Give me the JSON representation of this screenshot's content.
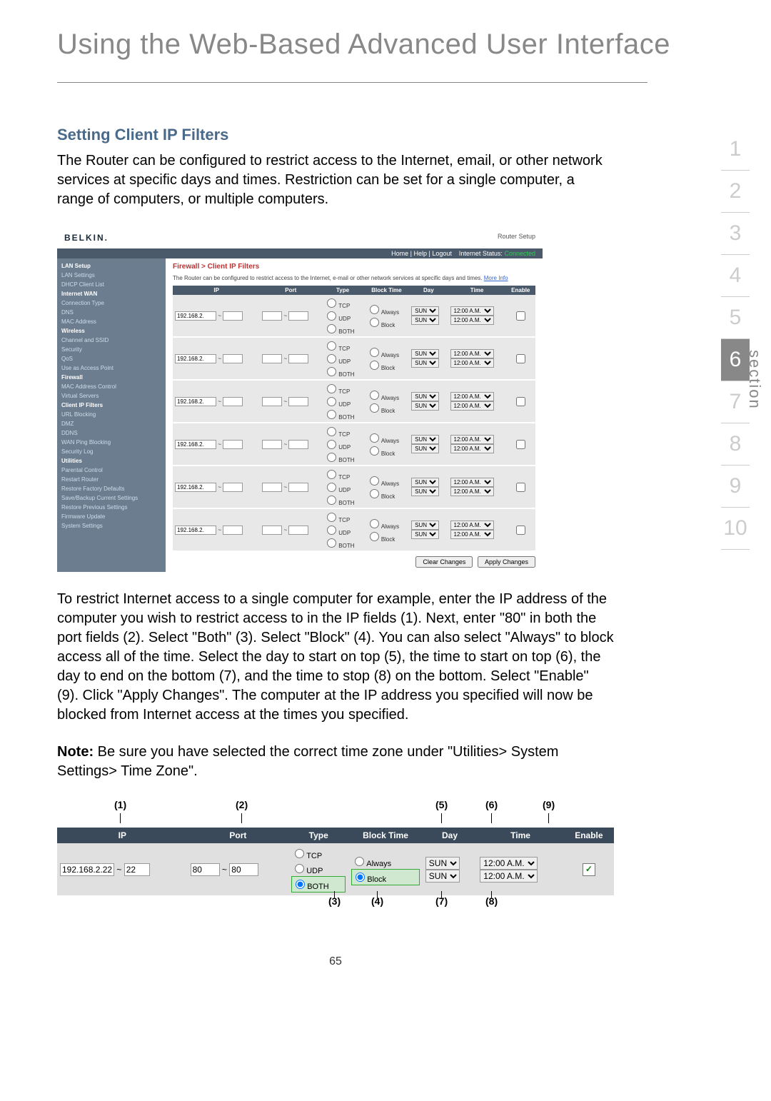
{
  "page_title": "Using the Web-Based Advanced User Interface",
  "section_nav": {
    "items": [
      "1",
      "2",
      "3",
      "4",
      "5",
      "6",
      "7",
      "8",
      "9",
      "10"
    ],
    "active": "6",
    "label": "section"
  },
  "subheading": "Setting Client IP Filters",
  "intro_text": "The Router can be configured to restrict access to the Internet, email, or other network services at specific days and times. Restriction can be set for a single computer, a range of computers, or multiple computers.",
  "router": {
    "brand": "BELKIN.",
    "subtitle": "Router Setup",
    "toplinks": "Home | Help | Logout",
    "status_label": "Internet Status:",
    "status_value": "Connected",
    "nav_groups": [
      {
        "cat": "LAN Setup",
        "items": [
          "LAN Settings",
          "DHCP Client List"
        ]
      },
      {
        "cat": "Internet WAN",
        "items": [
          "Connection Type",
          "DNS",
          "MAC Address"
        ]
      },
      {
        "cat": "Wireless",
        "items": [
          "Channel and SSID",
          "Security",
          "QoS",
          "Use as Access Point"
        ]
      },
      {
        "cat": "Firewall",
        "items": [
          "MAC Address Control",
          "Virtual Servers",
          "Client IP Filters",
          "URL Blocking",
          "DMZ",
          "DDNS",
          "WAN Ping Blocking",
          "Security Log"
        ]
      },
      {
        "cat": "Utilities",
        "items": [
          "Parental Control",
          "Restart Router",
          "Restore Factory Defaults",
          "Save/Backup Current Settings",
          "Restore Previous Settings",
          "Firmware Update",
          "System Settings"
        ]
      }
    ],
    "breadcrumb": "Firewall > Client IP Filters",
    "description": "The Router can be configured to restrict access to the Internet, e-mail or other network services at specific days and times.",
    "more_info": "More Info",
    "cols": [
      "IP",
      "Port",
      "Type",
      "Block Time",
      "Day",
      "Time",
      "Enable"
    ],
    "row": {
      "ip_prefix": "192.168.2.",
      "types": [
        "TCP",
        "UDP",
        "BOTH"
      ],
      "block_opts": [
        "Always",
        "Block"
      ],
      "day": "SUN",
      "time": "12:00 A.M."
    },
    "row_count": 6,
    "buttons": {
      "clear": "Clear Changes",
      "apply": "Apply Changes"
    }
  },
  "instructions": "To restrict Internet access to a single computer for example, enter the IP address of the computer you wish to restrict access to in the IP fields (1). Next, enter \"80\" in both the port fields (2). Select \"Both\" (3). Select \"Block\" (4). You can also select \"Always\" to block access all of the time. Select the day to start on top (5), the time to start on top (6), the day to end on the bottom (7), and the time to stop (8) on the bottom. Select \"Enable\" (9). Click \"Apply Changes\". The computer at the IP address you specified will now be blocked from Internet access at the times you specified.",
  "note_label": "Note:",
  "note_text": " Be sure you have selected the correct time zone under \"Utilities> System Settings> Time Zone\".",
  "callouts_top": {
    "1": "(1)",
    "2": "(2)",
    "5": "(5)",
    "6": "(6)",
    "9": "(9)"
  },
  "callouts_bottom": {
    "3": "(3)",
    "4": "(4)",
    "7": "(7)",
    "8": "(8)"
  },
  "big_row": {
    "ip_prefix": "192.168.2.",
    "ip_from": "22",
    "ip_to": "22",
    "port_from": "80",
    "port_to": "80",
    "types": [
      "TCP",
      "UDP",
      "BOTH"
    ],
    "type_sel": "BOTH",
    "block_opts": [
      "Always",
      "Block"
    ],
    "block_sel": "Block",
    "day": "SUN",
    "time": "12:00 A.M.",
    "enable_checked": true
  },
  "page_number": "65"
}
